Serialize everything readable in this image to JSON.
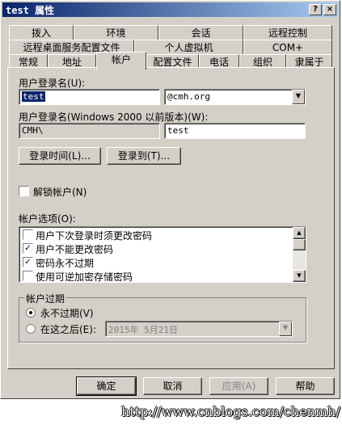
{
  "window": {
    "title": "test 属性",
    "help_btn": "?",
    "close_btn": "×"
  },
  "tabs": {
    "row1": [
      "拨入",
      "环境",
      "会话",
      "远程控制"
    ],
    "row2": [
      "远程桌面服务配置文件",
      "个人虚拟机",
      "COM+"
    ],
    "row3": [
      "常规",
      "地址",
      "帐户",
      "配置文件",
      "电话",
      "组织",
      "隶属于"
    ],
    "active": "帐户"
  },
  "account": {
    "logon_name_label": "用户登录名(U):",
    "logon_name_value": "test",
    "domain_value": "@cmh.org",
    "pre2000_label": "用户登录名(Windows 2000 以前版本)(W):",
    "pre2000_domain": "CMH\\",
    "pre2000_name": "test",
    "logon_hours_button": "登录时间(L)...",
    "logon_to_button": "登录到(T)...",
    "unlock_label": "解锁帐户(N)",
    "unlock_checked": false,
    "options_label": "帐户选项(O):",
    "options": [
      {
        "label": "用户下次登录时须更改密码",
        "checked": false
      },
      {
        "label": "用户不能更改密码",
        "checked": true
      },
      {
        "label": "密码永不过期",
        "checked": true
      },
      {
        "label": "使用可逆加密存储密码",
        "checked": false
      }
    ],
    "expires_group": "帐户过期",
    "never_label": "永不过期(V)",
    "end_of_label": "在这之后(E):",
    "expiry_selected": "never",
    "expiry_date": "2015年  5月21日"
  },
  "footer": {
    "ok": "确定",
    "cancel": "取消",
    "apply": "应用(A)",
    "help": "帮助"
  },
  "watermark": "http://www.cnblogs.com/chenmh/"
}
